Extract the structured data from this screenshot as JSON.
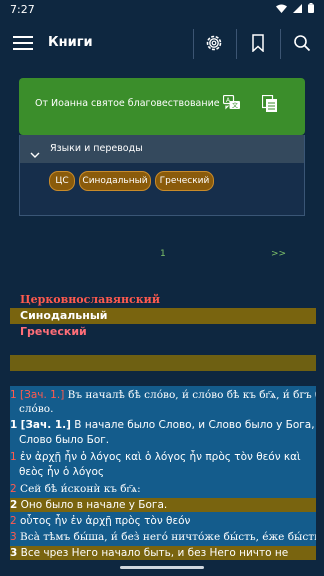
{
  "status": {
    "time": "7:27"
  },
  "toolbar": {
    "title": "Книги"
  },
  "book": {
    "title": "От Иоанна святое благовествование"
  },
  "languages": {
    "header": "Языки и переводы",
    "chips": [
      "ЦС",
      "Синодальный",
      "Греческий"
    ],
    "list": [
      {
        "label": "Церковнославянский",
        "color": "#ff5a4e"
      },
      {
        "label": "Синодальный",
        "color": "#ffffff"
      },
      {
        "label": "Греческий",
        "color": "#ff6e78"
      }
    ]
  },
  "pager": {
    "page": "1",
    "next": ">>"
  },
  "verses": [
    {
      "num": "1",
      "ref": "[Зач. 1.]",
      "text": "Въ началѣ бѣ слóво, и́ слóво бѣ къ бг҃ѧ, и́ бгъ бѣ"
    },
    {
      "num": "",
      "ref": "",
      "text": "слóво."
    },
    {
      "num": "1",
      "ref": "[Зач. 1.]",
      "text": "В начале было Слово, и Слово было у Бога, и"
    },
    {
      "num": "",
      "ref": "",
      "text": "Слово было Бог."
    },
    {
      "num": "1",
      "ref": "",
      "text": "ἐν ἀρχῇ ἦν ὁ λόγος καὶ ὁ λόγος ἦν πρὸς τὸν θεόν καὶ"
    },
    {
      "num": "",
      "ref": "",
      "text": "θεὸς ἦν ὁ λόγος"
    },
    {
      "num": "2",
      "ref": "",
      "text": "Сей бѣ и́сконѝ къ бг҃ѧ:"
    },
    {
      "num": "2",
      "ref": "",
      "text": "Оно было в начале у Бога."
    },
    {
      "num": "2",
      "ref": "",
      "text": "οὗτος ἦν ἐν ἀρχῇ πρὸς τὸν θεόν"
    },
    {
      "num": "3",
      "ref": "",
      "text": "Всà тѣмъ бы́ша, и́ без̀ негó ничтóже бы́сть, éже бы́сть."
    },
    {
      "num": "3",
      "ref": "",
      "text": "Все чрез Него начало быть, и без Него ничто не"
    }
  ],
  "colors": {
    "background": "#0e2740",
    "accent_green": "#3b8e2b",
    "chip": "#8a5b0b",
    "verse_bg": "#145c8c",
    "highlight": "#79640f"
  }
}
